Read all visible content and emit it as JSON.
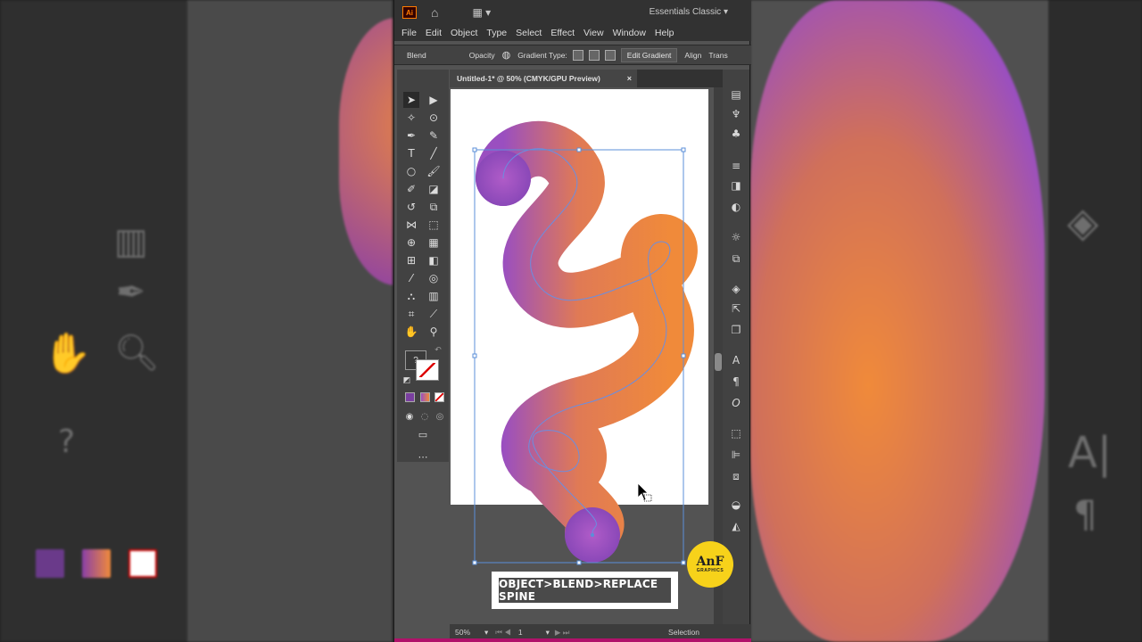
{
  "app": {
    "logo": "Ai",
    "workspace": "Essentials Classic"
  },
  "menu": [
    "File",
    "Edit",
    "Object",
    "Type",
    "Select",
    "Effect",
    "View",
    "Window",
    "Help"
  ],
  "control_bar": {
    "selection_label": "Blend",
    "opacity_label": "Opacity",
    "gradient_type_label": "Gradient Type:",
    "edit_gradient_label": "Edit Gradient",
    "align_label": "Align",
    "transform_label": "Trans"
  },
  "document_tab": {
    "title": "Untitled-1* @ 50% (CMYK/GPU Preview)",
    "close": "×"
  },
  "toolbar": {
    "fill_stroke_hint": "?"
  },
  "status_bar": {
    "zoom": "50%",
    "artboard_number": "1",
    "tool_name": "Selection"
  },
  "caption": "OBJECT>BLEND>REPLACE SPINE",
  "badge": {
    "line1": "AnF",
    "line2": "GRAPHICS"
  },
  "colors": {
    "blend_orange": "#f08a3a",
    "blend_purple": "#9a4fc0",
    "accent_pink": "#b0126a",
    "selection_blue": "#5b8fd8"
  }
}
